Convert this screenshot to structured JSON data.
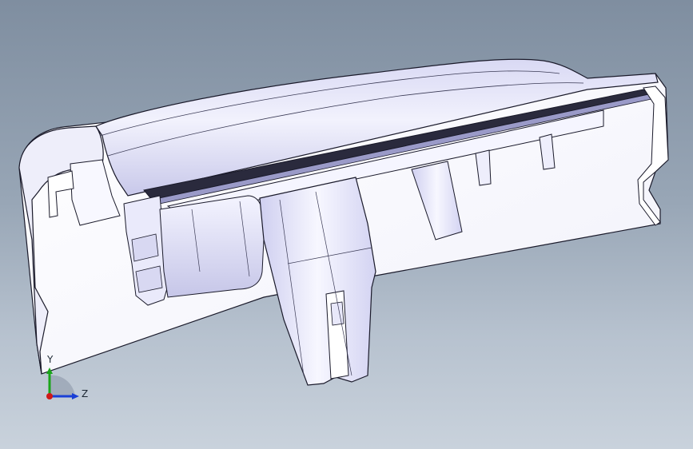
{
  "viewport": {
    "background_top": "#7f8ea0",
    "background_bottom": "#c9d2dc"
  },
  "model": {
    "icon": "cad-part-section-view",
    "shade_color": "#e6e6fb",
    "edge_color": "#1a1a2a"
  },
  "triad": {
    "y_label": "Y",
    "z_label": "Z",
    "y_axis_color": "#1aa51a",
    "z_axis_color": "#1a3fd6",
    "origin_color": "#d01818"
  }
}
